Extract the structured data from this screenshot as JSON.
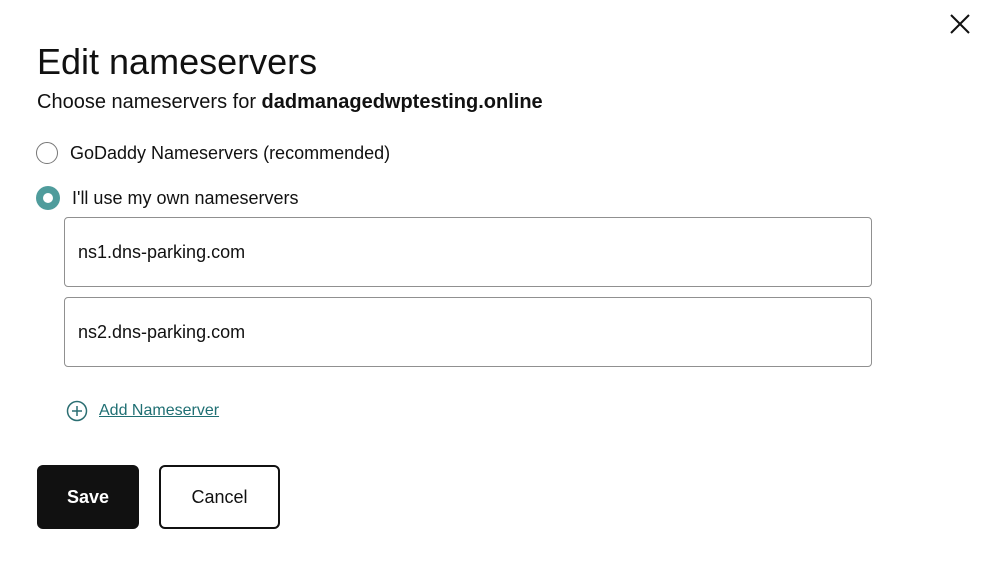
{
  "dialog": {
    "title": "Edit nameservers",
    "subtitle_prefix": "Choose nameservers for",
    "domain": "dadmanagedwptesting.online",
    "close_icon": "close-icon"
  },
  "options": [
    {
      "label": "GoDaddy Nameservers (recommended)",
      "selected": false
    },
    {
      "label": "I'll use my own nameservers",
      "selected": true
    }
  ],
  "nameservers": [
    {
      "value": "ns1.dns-parking.com"
    },
    {
      "value": "ns2.dns-parking.com"
    }
  ],
  "add_nameserver": {
    "label": "Add Nameserver",
    "icon": "plus-circle-icon"
  },
  "actions": {
    "save_label": "Save",
    "cancel_label": "Cancel"
  },
  "colors": {
    "accent": "#4f9c9c",
    "link": "#1f6f73",
    "primary_button": "#111111"
  }
}
